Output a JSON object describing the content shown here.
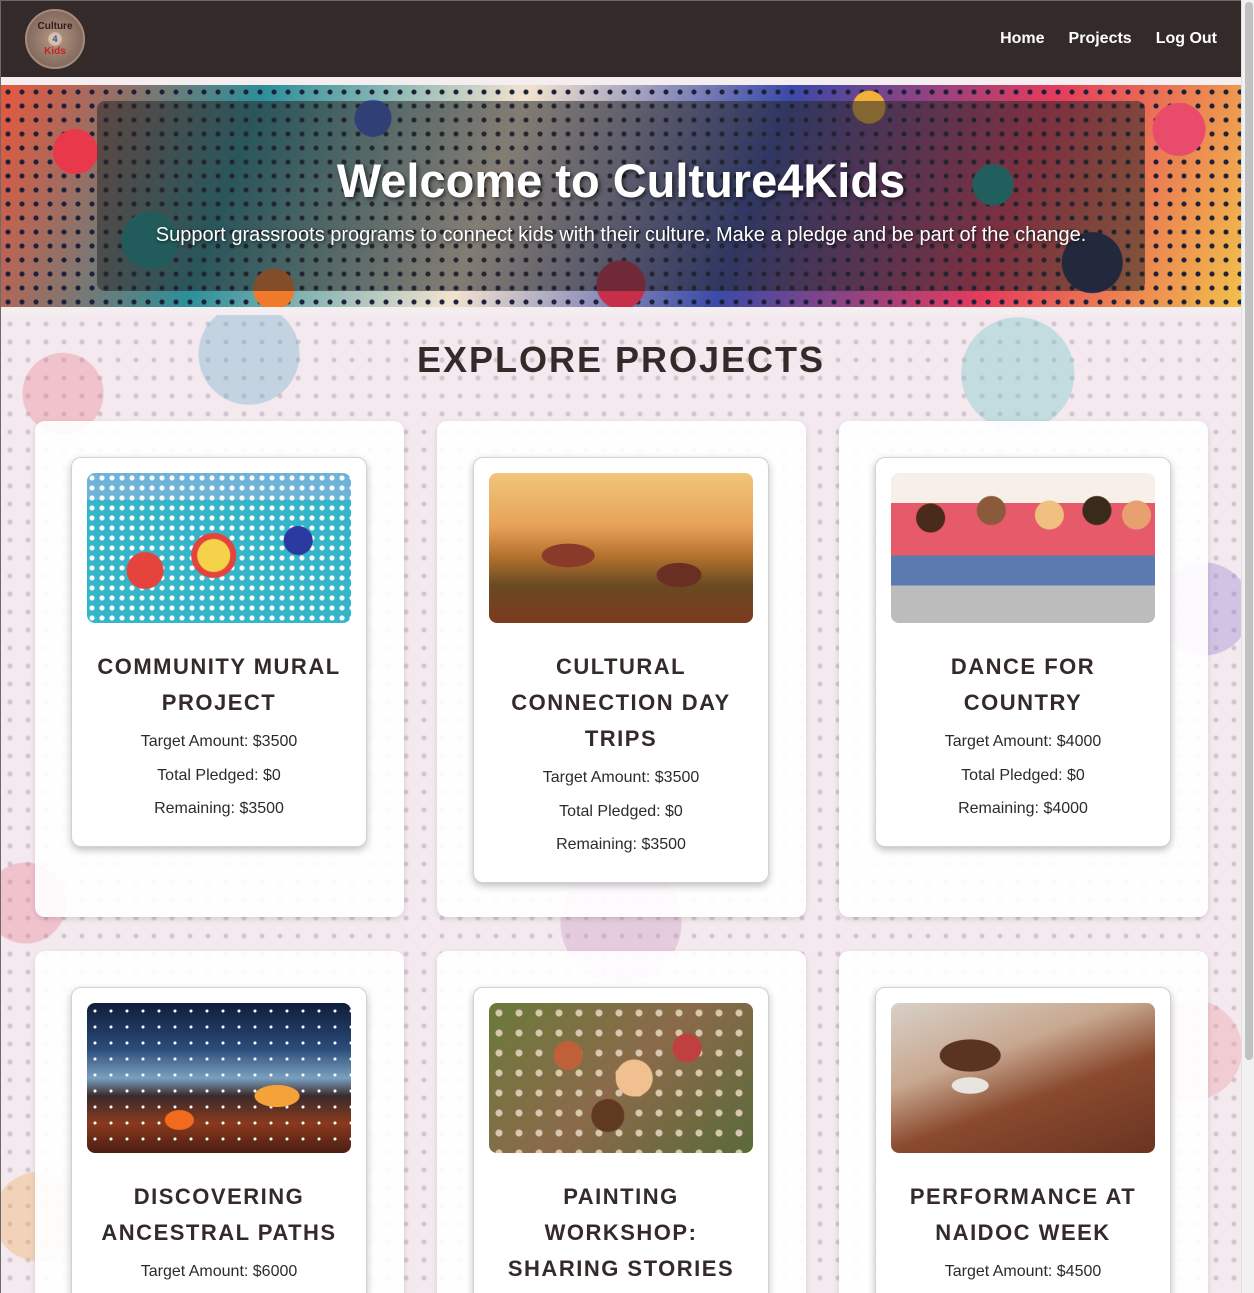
{
  "nav": {
    "logo": {
      "line1": "Culture",
      "line2": "4",
      "line3": "Kids"
    },
    "links": [
      "Home",
      "Projects",
      "Log Out"
    ]
  },
  "hero": {
    "title": "Welcome to Culture4Kids",
    "subtitle": "Support grassroots programs to connect kids with their culture. Make a pledge and be part of the change."
  },
  "section_title": "EXPLORE PROJECTS",
  "projects": [
    {
      "title": "COMMUNITY MURAL PROJECT",
      "target": "Target Amount: $3500",
      "pledged": "Total Pledged: $0",
      "remaining": "Remaining: $3500",
      "image": "mural-image"
    },
    {
      "title": "CULTURAL CONNECTION DAY TRIPS",
      "target": "Target Amount: $3500",
      "pledged": "Total Pledged: $0",
      "remaining": "Remaining: $3500",
      "image": "day-trip-image"
    },
    {
      "title": "DANCE FOR COUNTRY",
      "target": "Target Amount: $4000",
      "pledged": "Total Pledged: $0",
      "remaining": "Remaining: $4000",
      "image": "dance-image"
    },
    {
      "title": "DISCOVERING ANCESTRAL PATHS",
      "target": "Target Amount: $6000",
      "image": "campfire-image"
    },
    {
      "title": "PAINTING WORKSHOP: SHARING STORIES",
      "image": "painting-workshop-image"
    },
    {
      "title": "PERFORMANCE AT NAIDOC WEEK",
      "target": "Target Amount: $4500",
      "image": "didgeridoo-image"
    }
  ],
  "colors": {
    "nav_bg": "#342a2a",
    "title_text": "#342a2a"
  }
}
